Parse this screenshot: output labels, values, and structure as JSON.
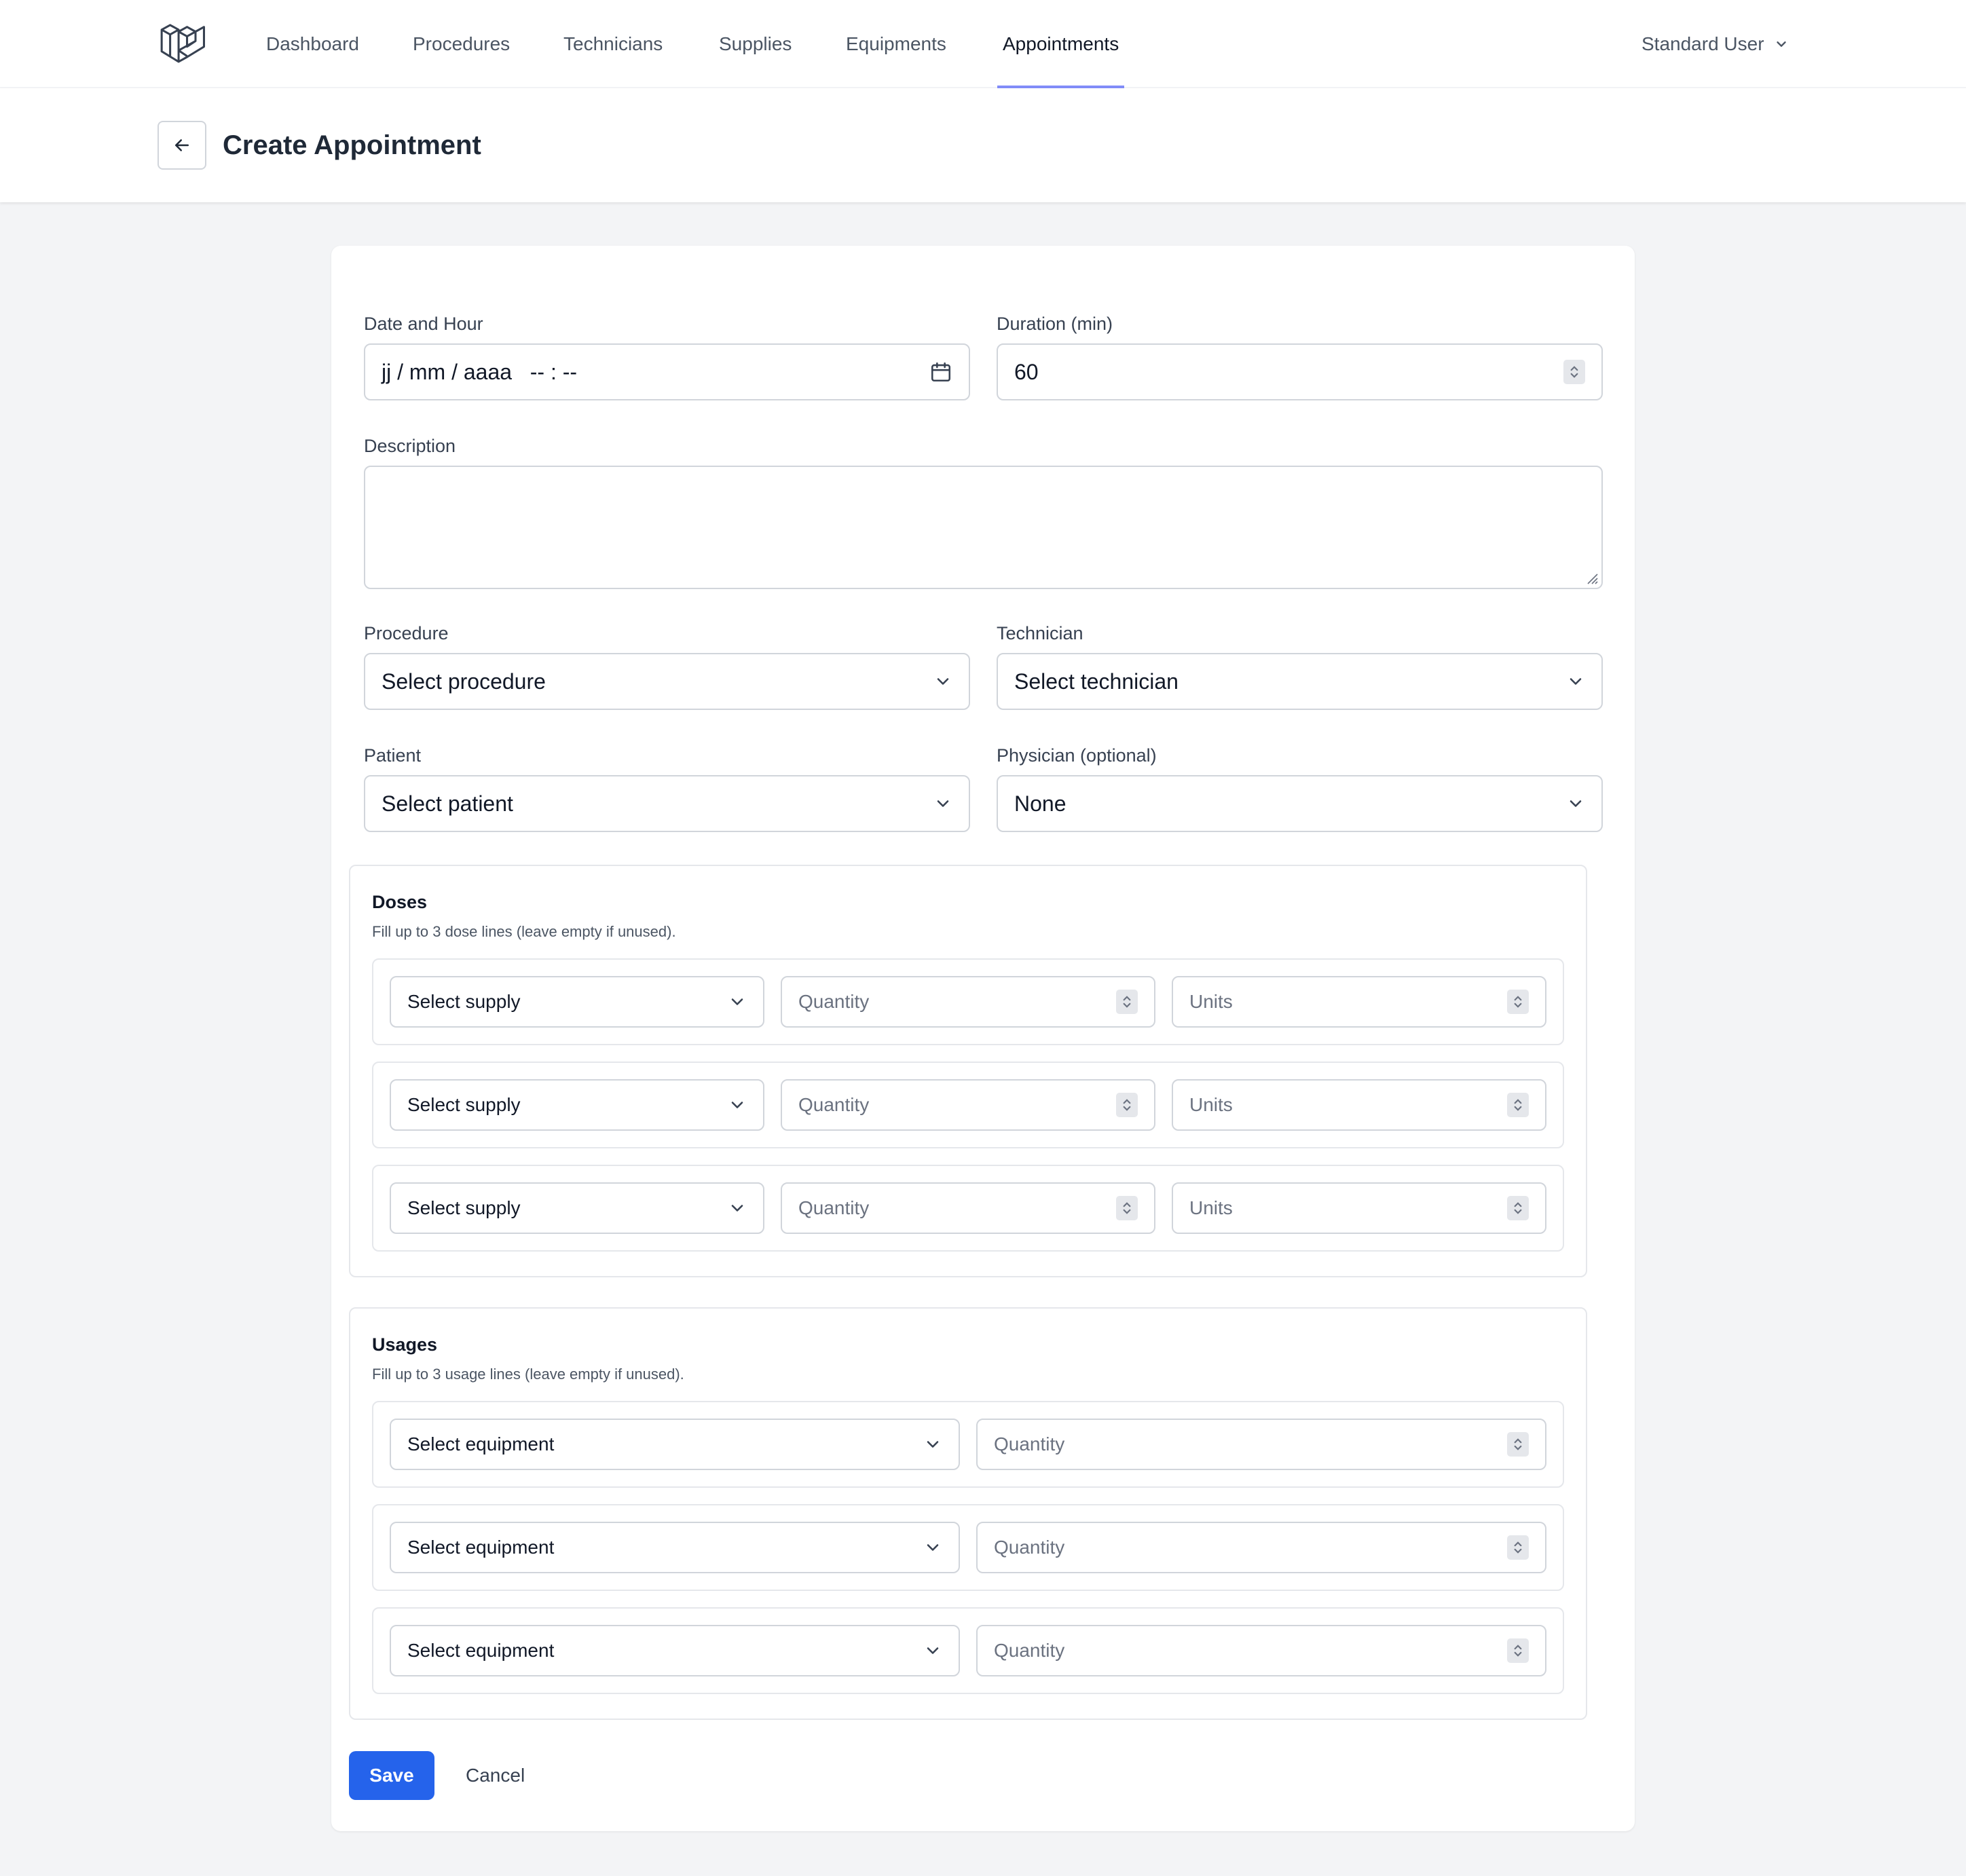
{
  "nav": {
    "links": [
      "Dashboard",
      "Procedures",
      "Technicians",
      "Supplies",
      "Equipments",
      "Appointments"
    ],
    "active": "Appointments",
    "user": "Standard User"
  },
  "header": {
    "title": "Create Appointment"
  },
  "form": {
    "date_label": "Date and Hour",
    "date_placeholder": "jj / mm / aaaa   -- : --",
    "duration_label": "Duration (min)",
    "duration_value": "60",
    "description_label": "Description",
    "description_value": "",
    "procedure_label": "Procedure",
    "procedure_value": "Select procedure",
    "technician_label": "Technician",
    "technician_value": "Select technician",
    "patient_label": "Patient",
    "patient_value": "Select patient",
    "physician_label": "Physician (optional)",
    "physician_value": "None"
  },
  "doses": {
    "title": "Doses",
    "hint": "Fill up to 3 dose lines (leave empty if unused).",
    "rows": [
      {
        "supply": "Select supply",
        "quantity_placeholder": "Quantity",
        "units_placeholder": "Units"
      },
      {
        "supply": "Select supply",
        "quantity_placeholder": "Quantity",
        "units_placeholder": "Units"
      },
      {
        "supply": "Select supply",
        "quantity_placeholder": "Quantity",
        "units_placeholder": "Units"
      }
    ]
  },
  "usages": {
    "title": "Usages",
    "hint": "Fill up to 3 usage lines (leave empty if unused).",
    "rows": [
      {
        "equipment": "Select equipment",
        "quantity_placeholder": "Quantity"
      },
      {
        "equipment": "Select equipment",
        "quantity_placeholder": "Quantity"
      },
      {
        "equipment": "Select equipment",
        "quantity_placeholder": "Quantity"
      }
    ]
  },
  "actions": {
    "save": "Save",
    "cancel": "Cancel"
  },
  "colors": {
    "primary": "#2563eb",
    "nav_active_underline": "#818cf8",
    "page_bg": "#f3f4f6"
  },
  "icons": {
    "logo": "laravel-logo-icon",
    "back": "arrow-left-icon",
    "calendar": "calendar-icon",
    "chevron": "chevron-down-icon",
    "spinner": "number-spinner-icon"
  }
}
